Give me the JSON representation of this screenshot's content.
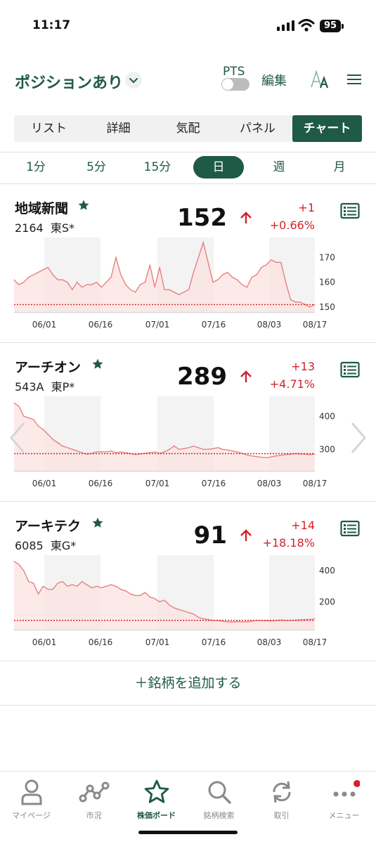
{
  "status": {
    "time": "11:17",
    "battery": "95"
  },
  "header": {
    "title": "ポジションあり",
    "pts_label": "PTS",
    "pts_on": false,
    "edit_label": "編集"
  },
  "view_tabs": [
    {
      "label": "リスト",
      "active": false
    },
    {
      "label": "詳細",
      "active": false
    },
    {
      "label": "気配",
      "active": false
    },
    {
      "label": "パネル",
      "active": false
    },
    {
      "label": "チャート",
      "active": true
    }
  ],
  "periods": [
    {
      "label": "1分",
      "active": false
    },
    {
      "label": "5分",
      "active": false
    },
    {
      "label": "15分",
      "active": false
    },
    {
      "label": "日",
      "active": true
    },
    {
      "label": "週",
      "active": false
    },
    {
      "label": "月",
      "active": false
    }
  ],
  "stocks": [
    {
      "name": "地域新聞",
      "code": "2164",
      "market": "東S*",
      "price": "152",
      "change": "+1",
      "change_pct": "+0.66%",
      "chart_data": {
        "type": "area",
        "x_ticks": [
          "06/01",
          "06/16",
          "07/01",
          "07/16",
          "08/03",
          "08/17"
        ],
        "y_ticks": [
          "150",
          "160",
          "170"
        ],
        "ylim": [
          148,
          178
        ],
        "reference_line": 151,
        "values": [
          161,
          159,
          160,
          162,
          163,
          164,
          165,
          166,
          163,
          161,
          161,
          160,
          157,
          160,
          158,
          159,
          159,
          160,
          158,
          160,
          162,
          170,
          163,
          159,
          157,
          156,
          159,
          160,
          167,
          158,
          166,
          157,
          157,
          156,
          155,
          156,
          157,
          164,
          170,
          176,
          168,
          160,
          161,
          163,
          164,
          162,
          161,
          159,
          158,
          162,
          163,
          166,
          167,
          169,
          168,
          168,
          160,
          153,
          152,
          152,
          151,
          150,
          151
        ]
      }
    },
    {
      "name": "アーチオン",
      "code": "543A",
      "market": "東P*",
      "price": "289",
      "change": "+13",
      "change_pct": "+4.71%",
      "chart_data": {
        "type": "area",
        "x_ticks": [
          "06/01",
          "06/16",
          "07/01",
          "07/16",
          "08/03",
          "08/17"
        ],
        "y_ticks": [
          "300",
          "400"
        ],
        "ylim": [
          235,
          460
        ],
        "reference_line": 287,
        "values": [
          440,
          430,
          400,
          395,
          390,
          370,
          360,
          345,
          330,
          320,
          310,
          305,
          300,
          295,
          290,
          285,
          288,
          292,
          293,
          292,
          295,
          290,
          292,
          290,
          287,
          284,
          286,
          288,
          290,
          292,
          288,
          292,
          300,
          310,
          300,
          302,
          305,
          310,
          305,
          300,
          300,
          302,
          305,
          300,
          298,
          295,
          292,
          288,
          283,
          280,
          278,
          276,
          275,
          277,
          280,
          282,
          284,
          285,
          287,
          286,
          285,
          284,
          286
        ]
      }
    },
    {
      "name": "アーキテク",
      "code": "6085",
      "market": "東G*",
      "price": "91",
      "change": "+14",
      "change_pct": "+18.18%",
      "chart_data": {
        "type": "area",
        "x_ticks": [
          "06/01",
          "06/16",
          "07/01",
          "07/16",
          "08/03",
          "08/17"
        ],
        "y_ticks": [
          "200",
          "400"
        ],
        "ylim": [
          20,
          500
        ],
        "reference_line": 80,
        "values": [
          460,
          440,
          400,
          330,
          320,
          250,
          300,
          280,
          280,
          320,
          330,
          300,
          310,
          300,
          330,
          310,
          290,
          300,
          290,
          300,
          310,
          300,
          280,
          270,
          250,
          240,
          240,
          260,
          230,
          220,
          200,
          210,
          180,
          160,
          150,
          140,
          130,
          120,
          100,
          90,
          85,
          80,
          80,
          75,
          70,
          70,
          72,
          70,
          70,
          75,
          80,
          80,
          78,
          76,
          80,
          82,
          80,
          80,
          81,
          83,
          85,
          86,
          90
        ]
      }
    }
  ],
  "add_label": "＋銘柄を追加する",
  "bottom_nav": [
    {
      "label": "マイページ",
      "icon": "person-icon",
      "active": false
    },
    {
      "label": "市況",
      "icon": "market-icon",
      "active": false
    },
    {
      "label": "株価ボード",
      "icon": "star-icon",
      "active": true
    },
    {
      "label": "銘柄検索",
      "icon": "search-icon",
      "active": false
    },
    {
      "label": "取引",
      "icon": "trade-icon",
      "active": false
    },
    {
      "label": "メニュー",
      "icon": "more-icon",
      "active": false,
      "badge": true
    }
  ],
  "colors": {
    "brand": "#1f5a46",
    "up": "#d3222a",
    "chart_line": "#e8817f",
    "chart_fill": "#fbe3e1"
  }
}
